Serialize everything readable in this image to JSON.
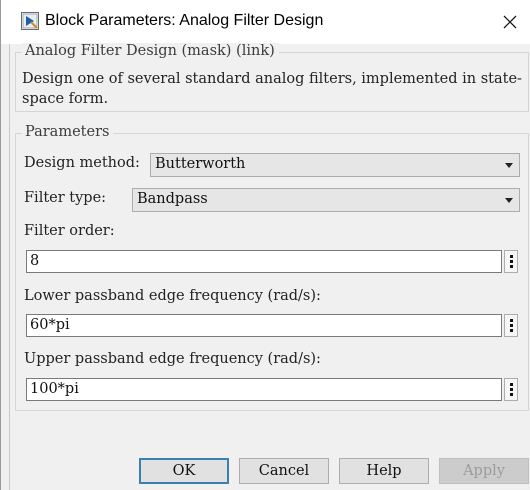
{
  "window": {
    "title": "Block Parameters: Analog Filter Design",
    "icon": "simulink-block-icon",
    "close_icon": "close-icon"
  },
  "mask": {
    "group_title": "Analog Filter Design (mask) (link)",
    "description": "Design one of several standard analog filters, implemented in state-space form."
  },
  "parameters": {
    "group_title": "Parameters",
    "design_method": {
      "label": "Design method:",
      "value": "Butterworth"
    },
    "filter_type": {
      "label": "Filter type:",
      "value": "Bandpass"
    },
    "filter_order": {
      "label": "Filter order:",
      "value": "8"
    },
    "lower_edge": {
      "label": "Lower passband edge frequency (rad/s):",
      "value": "60*pi"
    },
    "upper_edge": {
      "label": "Upper passband edge frequency (rad/s):",
      "value": "100*pi"
    }
  },
  "buttons": {
    "ok": "OK",
    "cancel": "Cancel",
    "help": "Help",
    "apply": "Apply"
  }
}
